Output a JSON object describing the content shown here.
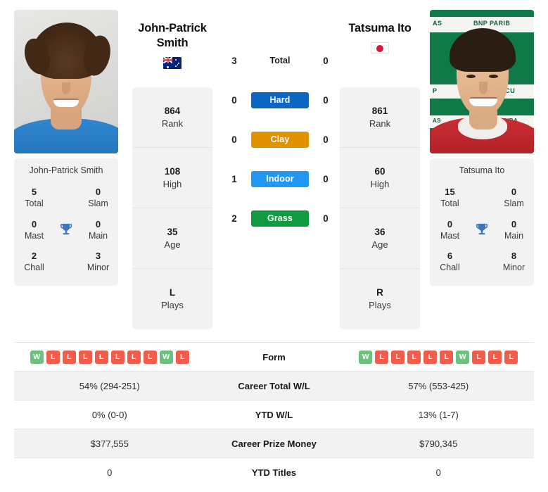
{
  "players": {
    "left": {
      "name": "John-Patrick Smith",
      "display_name_line1": "John-Patrick",
      "display_name_line2": "Smith",
      "country_flag": "australia-flag",
      "photo": "player-photo-left",
      "info_cards": [
        {
          "value": "864",
          "label": "Rank"
        },
        {
          "value": "108",
          "label": "High"
        },
        {
          "value": "35",
          "label": "Age"
        },
        {
          "value": "L",
          "label": "Plays"
        }
      ],
      "titles": [
        {
          "value": "5",
          "label": "Total"
        },
        {
          "value": "0",
          "label": "Slam"
        },
        {
          "value": "0",
          "label": "Mast"
        },
        {
          "value": "0",
          "label": "Main"
        },
        {
          "value": "2",
          "label": "Chall"
        },
        {
          "value": "3",
          "label": "Minor"
        }
      ],
      "form": [
        "W",
        "L",
        "L",
        "L",
        "L",
        "L",
        "L",
        "L",
        "W",
        "L"
      ],
      "career_total_wl": "54% (294-251)",
      "ytd_wl": "0% (0-0)",
      "career_prize_money": "$377,555",
      "ytd_titles": "0"
    },
    "right": {
      "name": "Tatsuma Ito",
      "display_name_line1": "Tatsuma Ito",
      "display_name_line2": "",
      "country_flag": "japan-flag",
      "photo": "player-photo-right",
      "info_cards": [
        {
          "value": "861",
          "label": "Rank"
        },
        {
          "value": "60",
          "label": "High"
        },
        {
          "value": "36",
          "label": "Age"
        },
        {
          "value": "R",
          "label": "Plays"
        }
      ],
      "titles": [
        {
          "value": "15",
          "label": "Total"
        },
        {
          "value": "0",
          "label": "Slam"
        },
        {
          "value": "0",
          "label": "Mast"
        },
        {
          "value": "0",
          "label": "Main"
        },
        {
          "value": "6",
          "label": "Chall"
        },
        {
          "value": "8",
          "label": "Minor"
        }
      ],
      "form": [
        "W",
        "L",
        "L",
        "L",
        "L",
        "L",
        "W",
        "L",
        "L",
        "L"
      ],
      "career_total_wl": "57% (553-425)",
      "ytd_wl": "13% (1-7)",
      "career_prize_money": "$790,345",
      "ytd_titles": "0"
    }
  },
  "head_to_head": {
    "rows": [
      {
        "label": "Total",
        "left": "3",
        "right": "0",
        "color": "",
        "pill": false
      },
      {
        "label": "Hard",
        "left": "0",
        "right": "0",
        "color": "#0b66c3",
        "pill": true
      },
      {
        "label": "Clay",
        "left": "0",
        "right": "0",
        "color": "#e09200",
        "pill": true
      },
      {
        "label": "Indoor",
        "left": "1",
        "right": "0",
        "color": "#2196f3",
        "pill": true
      },
      {
        "label": "Grass",
        "left": "2",
        "right": "0",
        "color": "#109b40",
        "pill": true
      }
    ]
  },
  "stats_table": {
    "rows": [
      {
        "label": "Form",
        "type": "form"
      },
      {
        "label": "Career Total W/L",
        "type": "text",
        "key": "career_total_wl"
      },
      {
        "label": "YTD W/L",
        "type": "text",
        "key": "ytd_wl"
      },
      {
        "label": "Career Prize Money",
        "type": "text",
        "key": "career_prize_money"
      },
      {
        "label": "YTD Titles",
        "type": "text",
        "key": "ytd_titles"
      }
    ]
  },
  "icons": {
    "trophy": "trophy-icon"
  },
  "colors": {
    "hard": "#0b66c3",
    "clay": "#e09200",
    "indoor": "#2196f3",
    "grass": "#109b40",
    "win_badge": "#6dc080",
    "loss_badge": "#f25c4a",
    "panel_bg": "#f2f2f2"
  }
}
